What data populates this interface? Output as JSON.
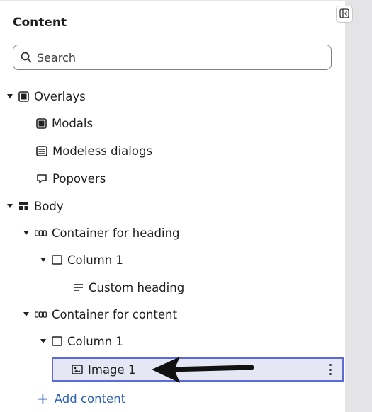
{
  "panel": {
    "title": "Content"
  },
  "search": {
    "placeholder": "Search"
  },
  "tree": {
    "overlays": "Overlays",
    "modals": "Modals",
    "modeless": "Modeless dialogs",
    "popovers": "Popovers",
    "body": "Body",
    "container_heading": "Container for heading",
    "column1_a": "Column 1",
    "custom_heading": "Custom heading",
    "container_content": "Container for content",
    "column1_b": "Column 1",
    "image1": "Image 1"
  },
  "actions": {
    "add_content": "Add content"
  },
  "icons": {
    "search": "search-icon",
    "collapse": "collapse-panel-icon",
    "overlay": "overlay-icon",
    "modal": "modal-icon",
    "modeless": "modeless-dialog-icon",
    "popover": "popover-icon",
    "body": "body-layout-icon",
    "container": "container-icon",
    "column": "column-icon",
    "text": "text-lines-icon",
    "image": "image-icon",
    "more": "more-vertical-icon",
    "plus": "plus-icon",
    "arrow": "annotation-arrow-icon"
  },
  "colors": {
    "accent": "#5c6bd6",
    "selected_bg": "#e5e7f5",
    "link": "#2b5fb8",
    "sidebar_strip": "#e4e4e6"
  }
}
